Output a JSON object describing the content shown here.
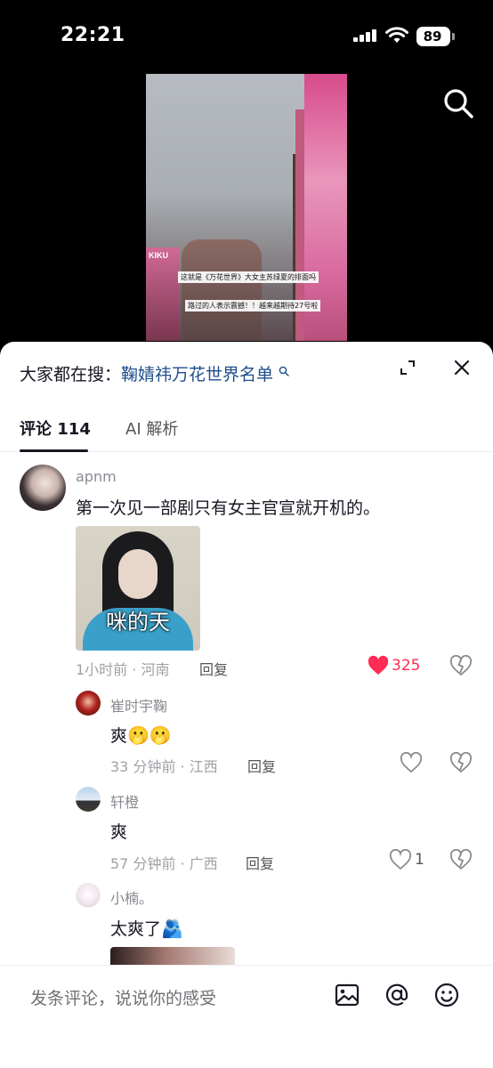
{
  "status_bar": {
    "time": "22:21",
    "battery": "89"
  },
  "video": {
    "caption_1": "这就是《万花世界》大女主苏绿夏的排面吗",
    "caption_2": "路过的人表示震撼！！越来越期待27号啦",
    "banner_text": "KIKU"
  },
  "panel": {
    "search_prefix": "大家都在搜：",
    "search_keyword": "鞠婧祎万花世界名单",
    "tabs": [
      {
        "label": "评论 114",
        "active": true
      },
      {
        "label": "AI 解析",
        "active": false
      }
    ]
  },
  "comments": [
    {
      "user": "apnm",
      "text": "第一次见一部剧只有女主官宣就开机的。",
      "sticker_text": "咪的天",
      "meta": "1小时前 · 河南",
      "reply_label": "回复",
      "likes": "325",
      "liked": true,
      "replies": [
        {
          "user": "崔时宇鞠",
          "text": "爽",
          "emoji": "🫢🫢",
          "meta": "33 分钟前 · 江西",
          "reply_label": "回复",
          "likes": ""
        },
        {
          "user": "轩橙",
          "text": "爽",
          "emoji": "",
          "meta": "57 分钟前 · 广西",
          "reply_label": "回复",
          "likes": "1"
        },
        {
          "user": "小楠。",
          "text": "太爽了",
          "emoji": "🫂",
          "meta": "",
          "reply_label": "",
          "likes": ""
        }
      ]
    }
  ],
  "bottom_bar": {
    "placeholder": "发条评论，说说你的感受",
    "icons": [
      "image-icon",
      "at-icon",
      "emoji-icon"
    ]
  },
  "colors": {
    "like_red": "#fe2c55",
    "keyword_blue": "#1e4e8c",
    "text_dark": "#161823"
  }
}
